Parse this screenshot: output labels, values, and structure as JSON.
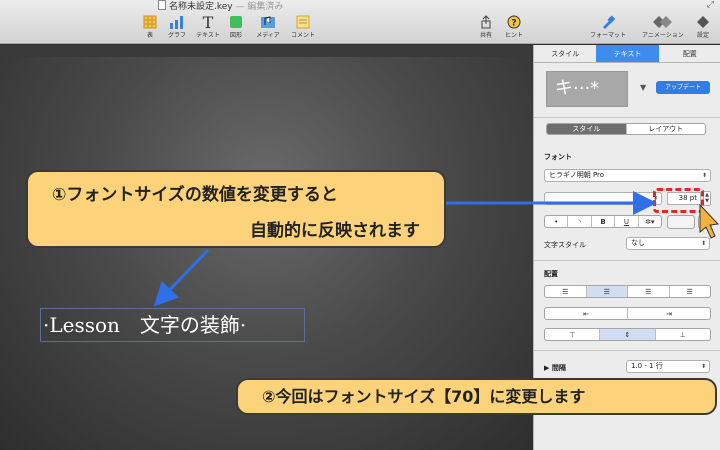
{
  "window": {
    "title": "名称未設定.key",
    "title_status": "— 編集済み"
  },
  "toolbar": {
    "left_items": [
      {
        "label": "表",
        "icon": "table-icon"
      },
      {
        "label": "グラフ",
        "icon": "chart-icon"
      },
      {
        "label": "テキスト",
        "icon": "text-icon"
      },
      {
        "label": "図形",
        "icon": "shape-icon"
      },
      {
        "label": "メディア",
        "icon": "media-icon"
      },
      {
        "label": "コメント",
        "icon": "comment-icon"
      }
    ],
    "right_items": [
      {
        "label": "共有",
        "icon": "share-icon"
      },
      {
        "label": "ヒント",
        "icon": "tips-icon"
      },
      {
        "label": "フォーマット",
        "icon": "format-brush-icon"
      },
      {
        "label": "アニメーション",
        "icon": "animation-icon"
      },
      {
        "label": "設定",
        "icon": "document-settings-icon"
      }
    ]
  },
  "slide": {
    "text": "·Lesson　文字の装飾·"
  },
  "inspector": {
    "tabs": [
      {
        "label": "スタイル",
        "active": false
      },
      {
        "label": "テキスト",
        "active": true
      },
      {
        "label": "配置",
        "active": false
      }
    ],
    "style_preview": "キ···*",
    "update_button": "アップデート",
    "subtabs": [
      {
        "label": "スタイル",
        "active": true
      },
      {
        "label": "レイアウト",
        "active": false
      }
    ],
    "font_section": "フォント",
    "font_family": "ヒラギノ明朝 Pro",
    "font_size": "38 pt",
    "format_buttons": [
      "•",
      "◝",
      "B",
      "U",
      "✲▾"
    ],
    "char_style_label": "文字スタイル",
    "char_style_value": "なし",
    "align_section": "配置",
    "spacing_label": "間隔",
    "spacing_value": "1.0 - 1 行"
  },
  "callouts": {
    "first_line1": "①フォントサイズの数値を変更すると",
    "first_line2": "自動的に反映されます",
    "second": "②今回はフォントサイズ【70】に変更します"
  },
  "colors": {
    "callout_fill": "#fcd37a",
    "arrow": "#2f6fe8",
    "highlight": "#e8232a",
    "active_tab": "#3d8cf0"
  }
}
